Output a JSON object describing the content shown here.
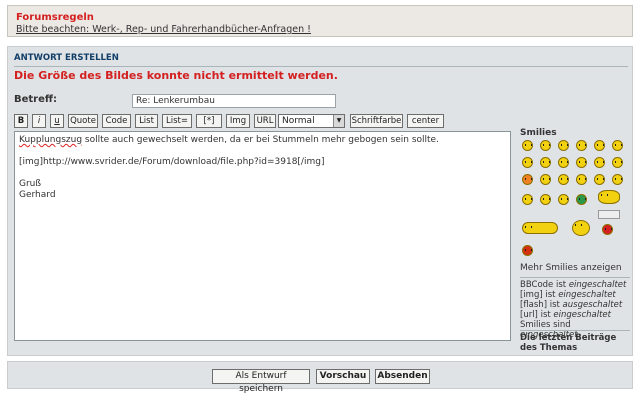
{
  "rules": {
    "title": "Forumsregeln",
    "link": "Bitte beachten: Werk-, Rep- und Fahrerhandbücher-Anfragen !"
  },
  "form": {
    "header": "ANTWORT ERSTELLEN",
    "error": "Die Größe des Bildes konnte nicht ermittelt werden.",
    "subject_label": "Betreff:",
    "subject_value": "Re: Lenkerumbau"
  },
  "toolbar": {
    "bold": "B",
    "italic": "i",
    "underline": "u",
    "quote": "Quote",
    "code": "Code",
    "list": "List",
    "list_eq": "List=",
    "list_item": "[*]",
    "img": "Img",
    "url": "URL",
    "font_size": "Normal",
    "font_color": "Schriftfarbe",
    "center": "center"
  },
  "editor": {
    "first_word": "Kupplungszug",
    "line1_rest": " sollte auch gewechselt werden, da er bei Stummeln mehr gebogen sein sollte.",
    "line2": "[img]http://www.svrider.de/Forum/download/file.php?id=3918[/img]",
    "line3": "Gruß",
    "line4": "Gerhard"
  },
  "sidebar": {
    "smilies_title": "Smilies",
    "more_smilies": "Mehr Smilies anzeigen",
    "bbcode_label": "BBCode ist ",
    "bbcode_state": "eingeschaltet",
    "img_label": "[img] ist ",
    "img_state": "eingeschaltet",
    "flash_label": "[flash] ist ",
    "flash_state": "ausgeschaltet",
    "url_label": "[url] ist ",
    "url_state": "eingeschaltet",
    "smilies_label": "Smilies sind ",
    "smilies_state": "eingeschaltet",
    "latest_posts": "Die letzten Beiträge des Themas"
  },
  "footer": {
    "save_draft": "Als Entwurf speichern",
    "preview": "Vorschau",
    "submit": "Absenden"
  },
  "colors": {
    "error_red": "#d42020",
    "header_blue": "#123f69",
    "panel_bg": "#dfe3e5"
  }
}
